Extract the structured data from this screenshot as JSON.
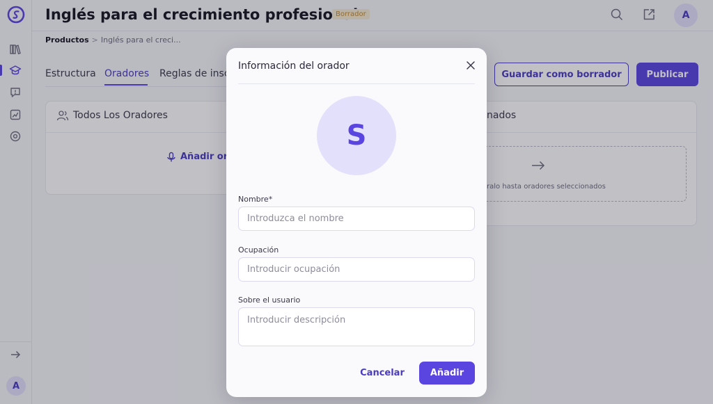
{
  "header": {
    "title": "Inglés para el crecimiento profesional",
    "status_badge": "Borrador",
    "user_initial": "A"
  },
  "breadcrumb": {
    "root": "Productos",
    "separator": ">",
    "current": "Inglés para el creci..."
  },
  "tabs": [
    {
      "label": "Estructura",
      "active": false
    },
    {
      "label": "Oradores",
      "active": true
    },
    {
      "label": "Reglas de insc",
      "active": false
    }
  ],
  "actions": {
    "save_draft_label": "Guardar como borrador",
    "publish_label": "Publicar"
  },
  "all_speakers_panel": {
    "title": "Todos Los Oradores",
    "add_label": "Añadir ora"
  },
  "selected_speakers_panel": {
    "title": "nados",
    "drop_hint": "ralo hasta oradores seleccionados"
  },
  "sidebar": {
    "icons": [
      "logo-icon",
      "library-icon",
      "course-icon",
      "feedback-icon",
      "analytics-icon",
      "settings-icon"
    ],
    "active_item": "course-icon",
    "expand_icon": "arrow-right-icon",
    "user_initial": "A"
  },
  "modal": {
    "title": "Información del orador",
    "avatar_initial": "S",
    "fields": {
      "name": {
        "label": "Nombre*",
        "placeholder": "Introduzca el nombre",
        "value": ""
      },
      "occupation": {
        "label": "Ocupación",
        "placeholder": "Introducir ocupación",
        "value": ""
      },
      "about": {
        "label": "Sobre el usuario",
        "placeholder": "Introducir descripción",
        "value": ""
      }
    },
    "cancel_label": "Cancelar",
    "add_label": "Añadir"
  },
  "colors": {
    "accent": "#5b45e0",
    "accent_light": "#e3e0fb",
    "badge_bg": "#f6ead2",
    "badge_text": "#c08a2e",
    "overlay": "rgba(30,28,48,0.28)"
  }
}
